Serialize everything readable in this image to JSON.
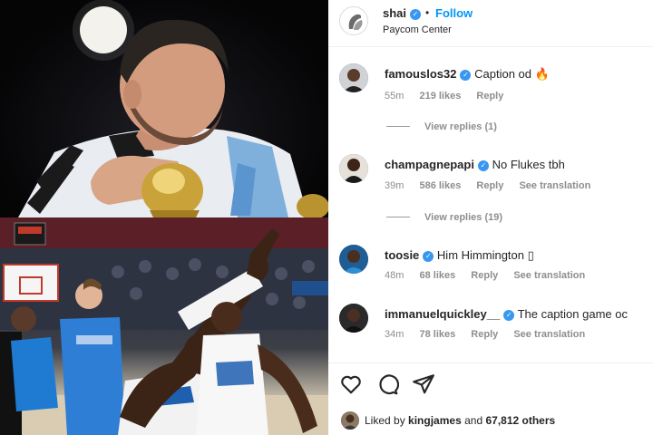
{
  "post": {
    "username": "shai",
    "follow_label": "Follow",
    "dot": "•",
    "location": "Paycom Center",
    "verified_mark": "✓"
  },
  "comments": [
    {
      "username": "famouslos32",
      "text": "Caption od 🔥",
      "time": "55m",
      "likes": "219 likes",
      "reply": "Reply",
      "translation": "",
      "view_replies": "View replies (1)"
    },
    {
      "username": "champagnepapi",
      "text": "No Flukes tbh",
      "time": "39m",
      "likes": "586 likes",
      "reply": "Reply",
      "translation": "See translation",
      "view_replies": "View replies (19)"
    },
    {
      "username": "toosie",
      "text": "Him Himmington ▯",
      "time": "48m",
      "likes": "68 likes",
      "reply": "Reply",
      "translation": "See translation",
      "view_replies": ""
    },
    {
      "username": "immanuelquickley__",
      "text": "The caption game oc",
      "time": "34m",
      "likes": "78 likes",
      "reply": "Reply",
      "translation": "See translation",
      "view_replies": ""
    }
  ],
  "actions": {
    "icons": [
      "heart-icon",
      "comment-icon",
      "share-icon"
    ]
  },
  "liked_by": {
    "prefix": "Liked by",
    "user": "kingjames",
    "middle": "and",
    "count": "67,812 others"
  },
  "colors": {
    "link": "#0095f6",
    "verified": "#3897f0",
    "muted": "#8e8e8e",
    "text": "#262626"
  }
}
